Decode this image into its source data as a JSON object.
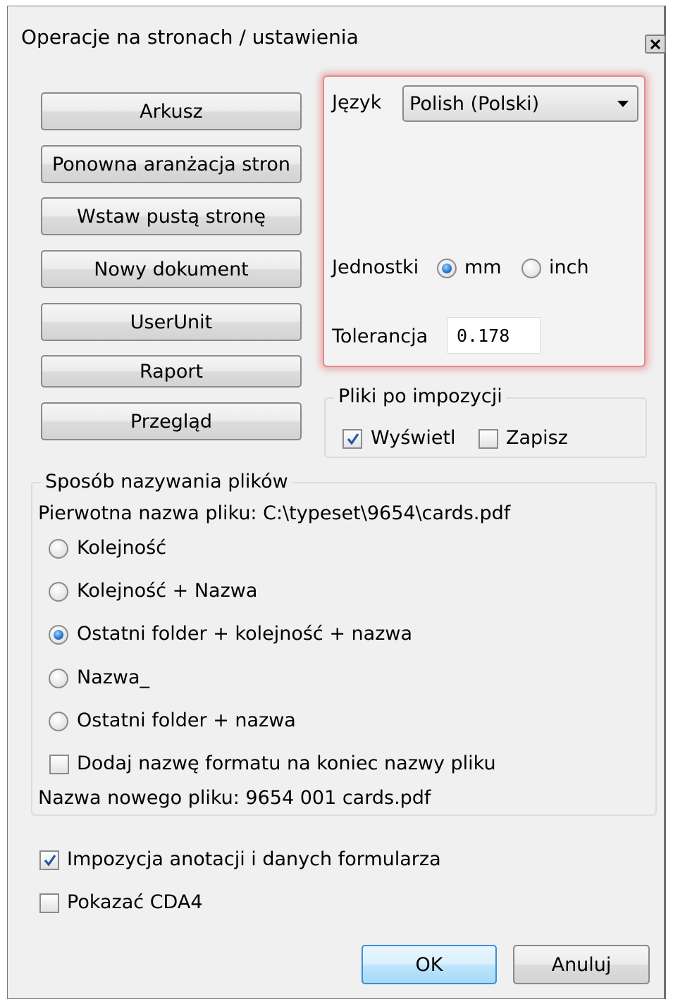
{
  "window": {
    "title": "Operacje na stronach / ustawienia"
  },
  "left_buttons": [
    {
      "label": "Arkusz"
    },
    {
      "label": "Ponowna aranżacja stron"
    },
    {
      "label": "Wstaw pustą stronę"
    },
    {
      "label": "Nowy dokument"
    },
    {
      "label": "UserUnit"
    },
    {
      "label": "Raport"
    },
    {
      "label": "Przegląd"
    }
  ],
  "settings": {
    "language_label": "Język",
    "language_value": "Polish (Polski)",
    "units_label": "Jednostki",
    "unit_mm": "mm",
    "unit_inch": "inch",
    "selected_unit": "mm",
    "tolerance_label": "Tolerancja",
    "tolerance_value": "0.178",
    "highlight_color": "#e28b8b"
  },
  "imposed_files": {
    "legend": "Pliki po impozycji",
    "show_label": "Wyświetl",
    "show_checked": true,
    "save_label": "Zapisz",
    "save_checked": false
  },
  "naming": {
    "legend": "Sposób nazywania plików",
    "original_name": "Pierwotna nazwa pliku: C:\\typeset\\9654\\cards.pdf",
    "options": [
      {
        "label": "Kolejność",
        "selected": false
      },
      {
        "label": "Kolejność + Nazwa",
        "selected": false
      },
      {
        "label": "Ostatni folder + kolejność + nazwa",
        "selected": true
      },
      {
        "label": "Nazwa_",
        "selected": false
      },
      {
        "label": "Ostatni folder + nazwa",
        "selected": false
      }
    ],
    "append_format_label": "Dodaj nazwę formatu na koniec nazwy pliku",
    "append_format_checked": false,
    "new_name": "Nazwa nowego pliku: 9654 001 cards.pdf"
  },
  "options": {
    "impose_annotations_label": "Impozycja anotacji i danych formularza",
    "impose_annotations_checked": true,
    "show_cda4_label": "Pokazać CDA4",
    "show_cda4_checked": false
  },
  "footer": {
    "ok_label": "OK",
    "cancel_label": "Anuluj"
  }
}
